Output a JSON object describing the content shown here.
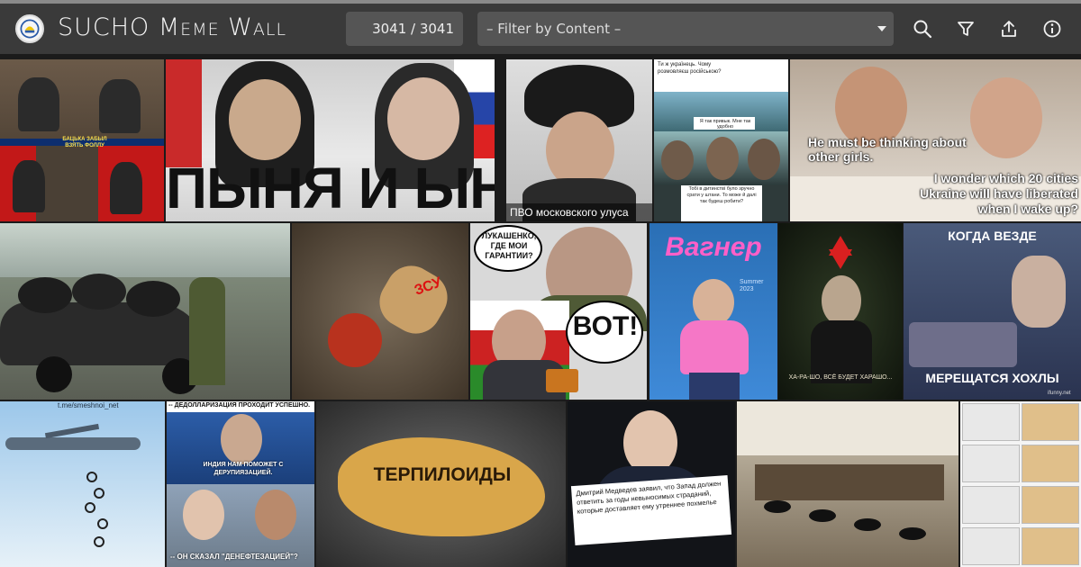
{
  "app": {
    "title": "SUCHO Meme Wall",
    "logo_icon": "sucho-logo"
  },
  "header": {
    "counter": "3041 / 3041",
    "filter_placeholder": "– Filter by Content –",
    "icons": [
      "search-icon",
      "filter-icon",
      "share-icon",
      "info-icon"
    ]
  },
  "tiles": [
    {
      "name": "meme-tile-1",
      "captions": [
        "БАЦЬКА ЗАБЫЛ ВЗЯТЬ ФОЛЛУ"
      ]
    },
    {
      "name": "meme-tile-2",
      "captions": [
        "ПЫНЯ И ЫНЯ"
      ]
    },
    {
      "name": "meme-tile-3",
      "captions": [
        "ПВО московского улуса"
      ]
    },
    {
      "name": "meme-tile-4",
      "captions": [
        "Ти ж українець. Чому розмовляєш російською?",
        "Я так привык. Мне так удобно",
        "Тобі в дитинстві було зручно срати у штани. То може й далі так будеш робити?"
      ]
    },
    {
      "name": "meme-tile-5",
      "captions": [
        "He must be thinking about other girls.",
        "I wonder which 20 cities Ukraine will have liberated when I wake up?"
      ]
    },
    {
      "name": "meme-tile-6",
      "captions": []
    },
    {
      "name": "meme-tile-7",
      "captions": [
        "ЗСУ"
      ]
    },
    {
      "name": "meme-tile-8",
      "captions": [
        "ЛУКАШЕНКО, ГДЕ МОИ ГАРАНТИИ?",
        "ВОТ!"
      ]
    },
    {
      "name": "meme-tile-9",
      "captions": [
        "Вагнер",
        "Summer 2023"
      ]
    },
    {
      "name": "meme-tile-10",
      "captions": [
        "ХА-РА-ШО, ВСЁ БУДЕТ ХАРАШО..."
      ]
    },
    {
      "name": "meme-tile-11",
      "captions": [
        "КОГДА ВЕЗДЕ",
        "МЕРЕЩАТСЯ ХОХЛЫ",
        "ifunny.net"
      ]
    },
    {
      "name": "meme-tile-12",
      "captions": [
        "t.me/smeshnoi_net"
      ]
    },
    {
      "name": "meme-tile-13",
      "captions": [
        "-- ДЕДОЛЛАРИЗАЦИЯ ПРОХОДИТ УСПЕШНО.",
        "ИНДИЯ НАМ ПОМОЖЕТ С ДЕРУПИЯЗАЦИЕЙ.",
        "-- ОН СКАЗАЛ \"ДЕНЕФТЕЗАЦИЕЙ\"?"
      ]
    },
    {
      "name": "meme-tile-14",
      "captions": [
        "ТЕРПИЛОИДЫ"
      ]
    },
    {
      "name": "meme-tile-15",
      "captions": [
        "Дмитрий Медведев заявил, что Запад должен ответить за годы невыносимых страданий, которые доставляет ему утреннее похмелье"
      ]
    },
    {
      "name": "meme-tile-16",
      "captions": []
    },
    {
      "name": "meme-tile-17",
      "captions": []
    }
  ]
}
